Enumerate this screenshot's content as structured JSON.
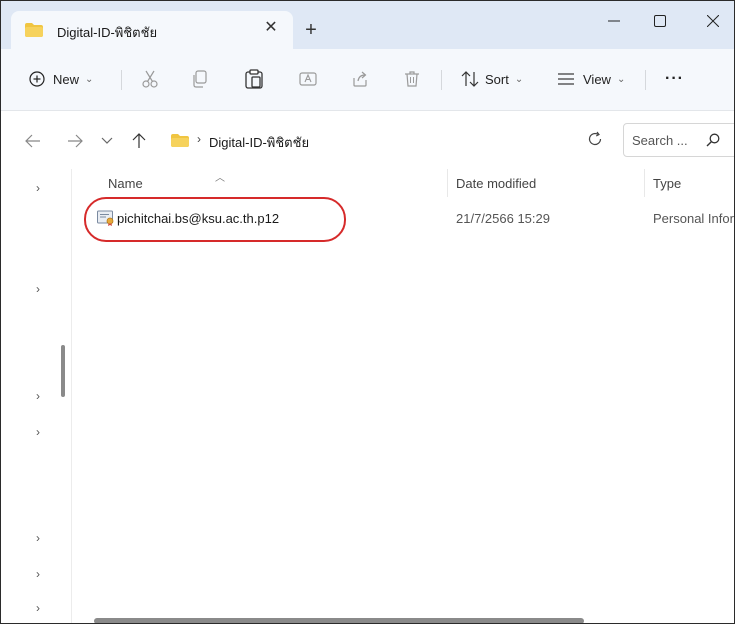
{
  "tab": {
    "title": "Digital-ID-พิชิตชัย",
    "close_symbol": "✕",
    "new_symbol": "+"
  },
  "window": {
    "minimize_symbol": "—",
    "maximize_symbol": "☐",
    "close_symbol": "✕"
  },
  "toolbar": {
    "new_label": "New",
    "sort_label": "Sort",
    "view_label": "View",
    "more_symbol": "···",
    "chevron": "⌄"
  },
  "address": {
    "breadcrumb_separator": "›",
    "folder": "Digital-ID-พิชิตชัย",
    "dropdown_symbol": "⌄"
  },
  "search": {
    "placeholder": "Search ..."
  },
  "columns": {
    "name": "Name",
    "date": "Date modified",
    "type": "Type"
  },
  "files": [
    {
      "name": "pichitchai.bs@ksu.ac.th.p12",
      "date": "21/7/2566 15:29",
      "type": "Personal Information Exchange"
    }
  ],
  "nav_chevron": "›",
  "colors": {
    "titlebar": "#dfe8f5",
    "folder": "#f0c541",
    "highlight": "#d62a2a"
  },
  "icons": [
    "folder-icon",
    "plus-circle-icon",
    "cut-icon",
    "copy-icon",
    "paste-icon",
    "rename-icon",
    "share-icon",
    "delete-icon",
    "sort-icon",
    "view-icon",
    "more-icon",
    "back-icon",
    "forward-icon",
    "recent-icon",
    "up-icon",
    "refresh-icon",
    "search-icon",
    "certificate-file-icon"
  ]
}
